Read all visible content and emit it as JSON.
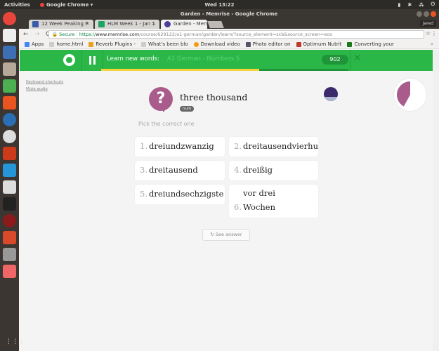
{
  "os": {
    "activities": "Activities",
    "app_name": "Google Chrome ▾",
    "clock": "Wed 13:22",
    "tray": [
      "network-icon",
      "settings-icon",
      "people-icon",
      "volume-icon",
      "power-icon"
    ]
  },
  "window": {
    "title": "Garden - Memrise - Google Chrome",
    "profile": "Jared"
  },
  "tabs": [
    {
      "label": "12 Week Peaking P",
      "color": "#3b5aa8"
    },
    {
      "label": "HLM Week 1 - Jan 1",
      "color": "#1ea362"
    },
    {
      "label": "Garden - Memrise",
      "color": "#4a3f9a",
      "active": true
    }
  ],
  "omnibox": {
    "secure": "Secure",
    "scheme": "https://",
    "host": "www.memrise.com",
    "path": "/course/629122/a1-german/garden/learn/?source_element=scb&source_screen=eos"
  },
  "bookmarks": [
    {
      "label": "Apps",
      "color": "#4285f4"
    },
    {
      "label": "home.html",
      "color": "#999"
    },
    {
      "label": "Reverb Plugins -",
      "color": "#e9a21f"
    },
    {
      "label": "What's been blo",
      "color": "#999"
    },
    {
      "label": "Download video",
      "color": "#f39c12"
    },
    {
      "label": "Photo editor on",
      "color": "#556"
    },
    {
      "label": "Optimum Nutrit",
      "color": "#c0392b"
    },
    {
      "label": "Converting your",
      "color": "#1a7a1a"
    }
  ],
  "session": {
    "title": "Learn new words:",
    "course": "A1 German - Numbers 5",
    "score": "902",
    "progress": 0.64,
    "accent": "#2ab748"
  },
  "sidebar_links": [
    "Keyboard shortcuts",
    "Mute audio"
  ],
  "question": {
    "prompt": "three thousand",
    "part_of_speech": "num",
    "instruction": "Pick the correct one",
    "choices": [
      {
        "n": "1.",
        "text": "dreiundzwanzig"
      },
      {
        "n": "2.",
        "text": "dreitausendvierhu"
      },
      {
        "n": "3.",
        "text": "dreitausend"
      },
      {
        "n": "4.",
        "text": "dreißig"
      },
      {
        "n": "5.",
        "text": "dreiundsechzigste"
      },
      {
        "n": "6.",
        "text": "vor drei Wochen"
      }
    ],
    "see_answer": "See answer",
    "timer_remaining": 0.42
  }
}
